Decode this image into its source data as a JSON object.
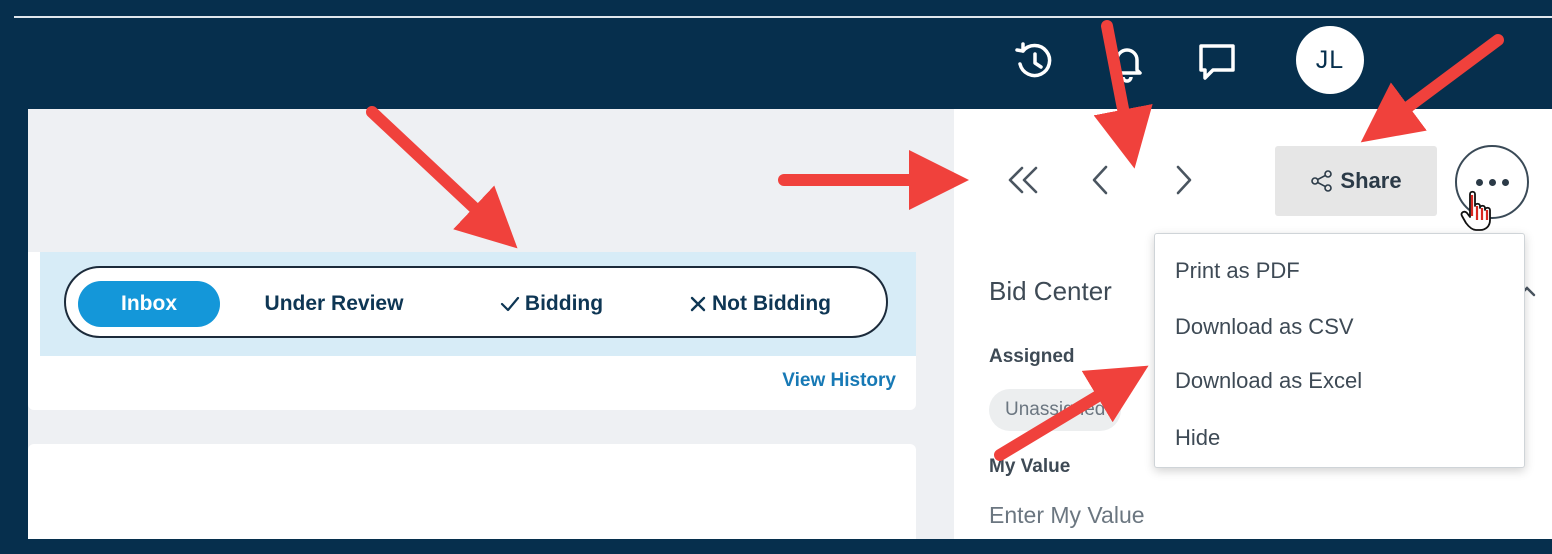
{
  "header": {
    "avatar_initials": "JL",
    "icons": [
      "history-icon",
      "bell-icon",
      "chat-icon"
    ]
  },
  "status_tabs": [
    {
      "label": "Inbox",
      "active": true
    },
    {
      "label": "Under Review",
      "active": false
    },
    {
      "label": "Bidding",
      "prefix_icon": "check-icon",
      "active": false
    },
    {
      "label": "Not Bidding",
      "prefix_icon": "x-icon",
      "active": false
    }
  ],
  "view_history_label": "View History",
  "nav": {
    "first_icon": "double-chevron-left-icon",
    "prev_icon": "chevron-left-icon",
    "next_icon": "chevron-right-icon"
  },
  "share_label": "Share",
  "more_icon": "more-horizontal-icon",
  "menu_items": [
    "Print as PDF",
    "Download as CSV",
    "Download as Excel",
    "Hide"
  ],
  "bid_center": {
    "title": "Bid Center",
    "assigned_label": "Assigned",
    "assigned_value": "Unassigned",
    "my_value_label": "My Value",
    "my_value_placeholder": "Enter My Value"
  },
  "colors": {
    "header_bg": "#062f4d",
    "active_tab": "#1497d9",
    "link": "#1779b5",
    "annotation_arrow": "#f0413c"
  }
}
